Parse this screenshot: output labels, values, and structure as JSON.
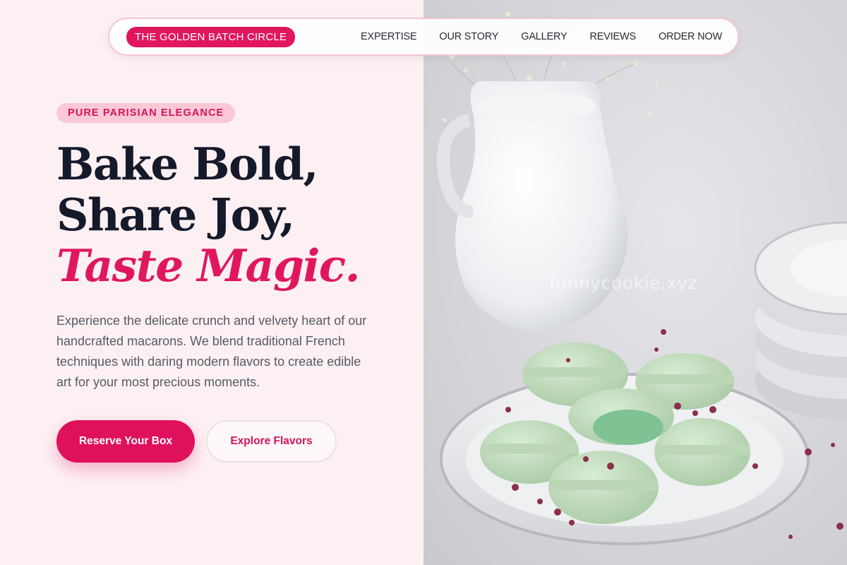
{
  "nav": {
    "brand": "THE GOLDEN BATCH CIRCLE",
    "items": [
      {
        "label": "EXPERTISE"
      },
      {
        "label": "OUR STORY"
      },
      {
        "label": "GALLERY"
      },
      {
        "label": "REVIEWS"
      },
      {
        "label": "ORDER NOW"
      }
    ]
  },
  "hero": {
    "tag": "PURE PARISIAN ELEGANCE",
    "line1": "Bake Bold,",
    "line2": "Share Joy,",
    "line3": "Taste Magic.",
    "description": "Experience the delicate crunch and velvety heart of our handcrafted macarons. We blend traditional French techniques with daring modern flavors to create edible art for your most precious moments.",
    "primary_cta": "Reserve Your Box",
    "secondary_cta": "Explore Flavors"
  },
  "image": {
    "watermark": "funnycookie.xyz"
  },
  "colors": {
    "accent": "#e0175e",
    "heading": "#151a2b",
    "background": "#fdf0f3",
    "pill_bg": "#fbc8d7"
  }
}
